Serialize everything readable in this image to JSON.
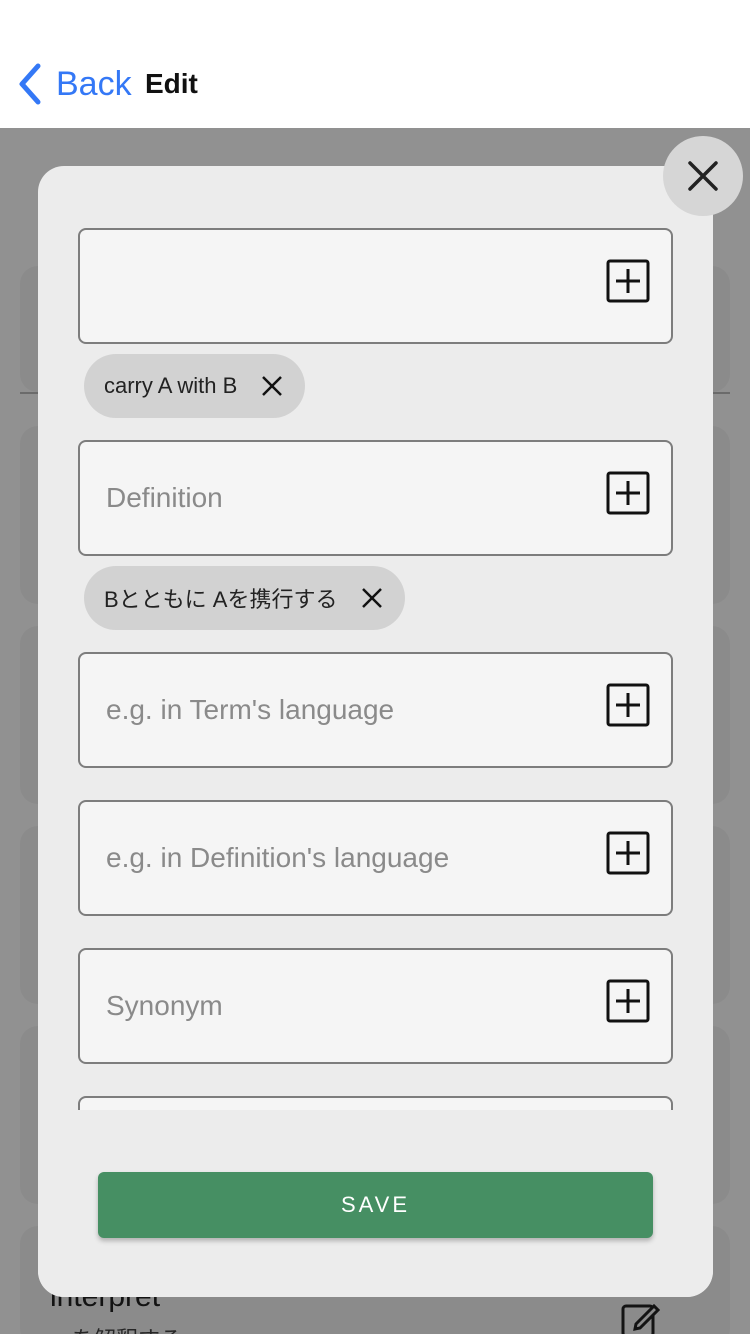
{
  "nav": {
    "back_label": "Back",
    "title": "Edit"
  },
  "background": {
    "word": "interpret",
    "sub": "…を解釈する"
  },
  "modal": {
    "fields": [
      {
        "value": "",
        "placeholder": ""
      },
      {
        "value": "",
        "placeholder": "Definition"
      },
      {
        "value": "",
        "placeholder": "e.g. in Term's language"
      },
      {
        "value": "",
        "placeholder": "e.g. in Definition's language"
      },
      {
        "value": "",
        "placeholder": "Synonym"
      }
    ],
    "chips": [
      {
        "label": "carry A with B"
      },
      {
        "label": "Bとともに Aを携行する"
      }
    ],
    "save_label": "SAVE"
  },
  "colors": {
    "accent": "#3478f6",
    "save": "#468f63",
    "modal_bg": "#ececec"
  },
  "icons": {
    "back": "chevron-left-icon",
    "close": "close-icon",
    "add": "plus-square-icon",
    "remove": "x-icon",
    "edit": "pencil-icon"
  }
}
